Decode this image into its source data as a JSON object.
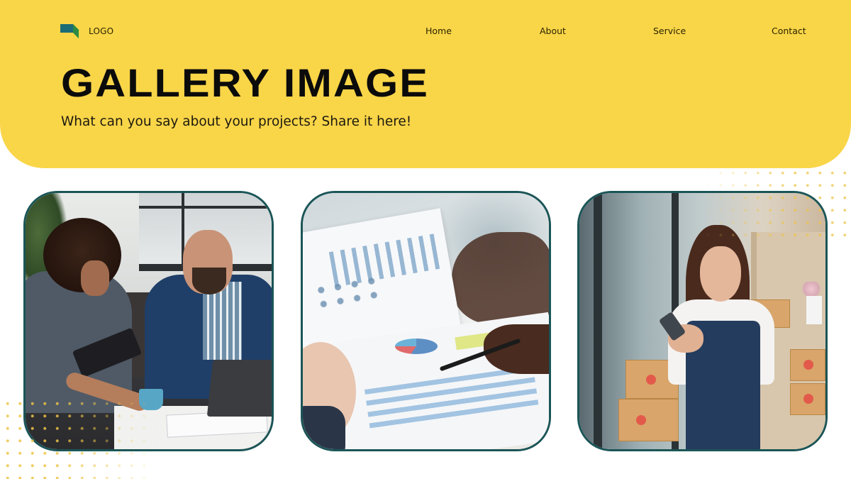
{
  "header": {
    "logo_text": "LOGO",
    "logo_icon": "flag-logo-icon",
    "nav": [
      {
        "label": "Home"
      },
      {
        "label": "About"
      },
      {
        "label": "Service"
      },
      {
        "label": "Contact"
      }
    ],
    "title": "GALLERY IMAGE",
    "subtitle": "What can you say about your projects? Share it here!"
  },
  "colors": {
    "header_bg": "#f9d548",
    "card_border": "#1b5557",
    "logo_green_dark": "#1e6b5e",
    "logo_green_light": "#2f8a4a",
    "dot_accent": "#eec446"
  },
  "gallery": [
    {
      "alt": "Two men working together on a laptop and tablet"
    },
    {
      "alt": "Hands reviewing printed business charts with a pen"
    },
    {
      "alt": "Smiling woman in an apron using a smartphone next to shipping boxes"
    }
  ]
}
